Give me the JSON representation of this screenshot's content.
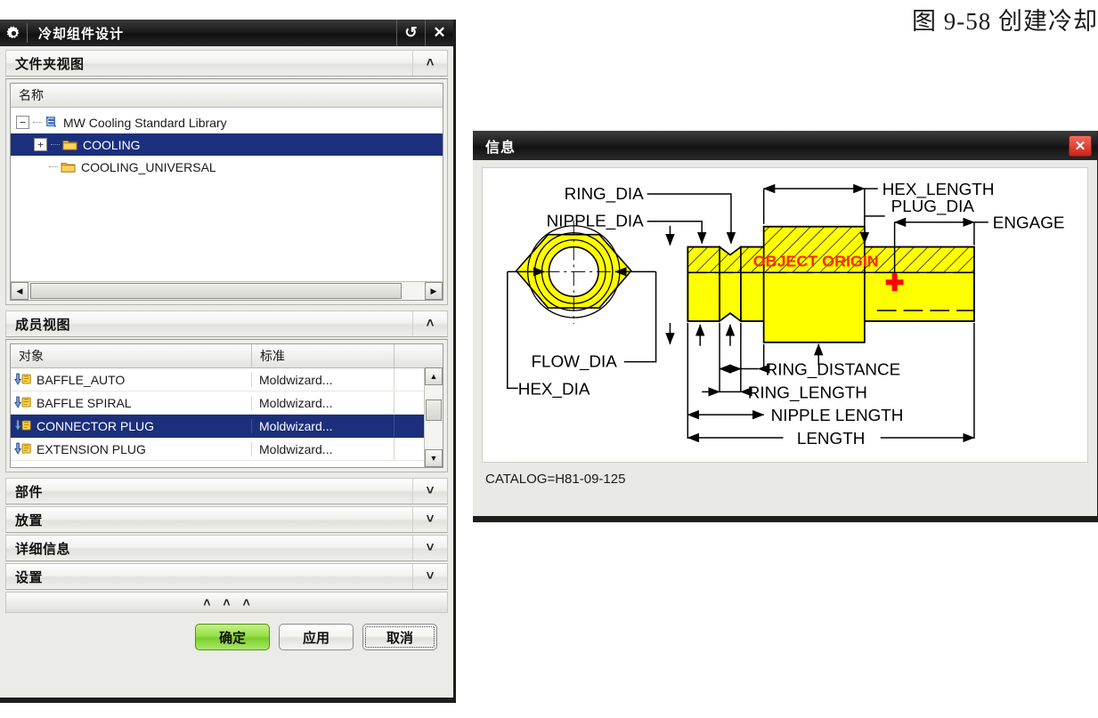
{
  "caption": "图 9-58  创建冷却",
  "dialog": {
    "title": "冷却组件设计",
    "icon": "gear-icon",
    "reset_label": "↺",
    "close_label": "✕",
    "sections": [
      {
        "label": "文件夹视图",
        "chevron": "˄",
        "expanded": true
      },
      {
        "label": "成员视图",
        "chevron": "˄",
        "expanded": true
      },
      {
        "label": "部件",
        "chevron": "˅",
        "expanded": false
      },
      {
        "label": "放置",
        "chevron": "˅",
        "expanded": false
      },
      {
        "label": "详细信息",
        "chevron": "˅",
        "expanded": false
      },
      {
        "label": "设置",
        "chevron": "˅",
        "expanded": false
      }
    ],
    "folder_view": {
      "column_header": "名称",
      "tree": [
        {
          "label": "MW Cooling Standard Library",
          "level": 0,
          "expander": "−",
          "icon": "library-icon",
          "selected": false
        },
        {
          "label": "COOLING",
          "level": 1,
          "expander": "+",
          "icon": "folder-icon",
          "selected": true
        },
        {
          "label": "COOLING_UNIVERSAL",
          "level": 1,
          "expander": "",
          "icon": "folder-icon",
          "selected": false
        }
      ],
      "hscroll": {
        "left_arrow": "◀",
        "right_arrow": "▶"
      }
    },
    "member_view": {
      "columns": [
        "对象",
        "标准",
        ""
      ],
      "rows": [
        {
          "object": "BAFFLE_AUTO",
          "standard": "Moldwizard...",
          "selected": false
        },
        {
          "object": "BAFFLE SPIRAL",
          "standard": "Moldwizard...",
          "selected": false
        },
        {
          "object": "CONNECTOR PLUG",
          "standard": "Moldwizard...",
          "selected": true
        },
        {
          "object": "EXTENSION PLUG",
          "standard": "Moldwizard...",
          "selected": false
        }
      ],
      "vscroll": {
        "up_arrow": "▲",
        "down_arrow": "▼"
      }
    },
    "collapse_all": {
      "marks": [
        "˄",
        "˄",
        "˄"
      ]
    },
    "buttons": {
      "ok": "确定",
      "apply": "应用",
      "cancel": "取消"
    }
  },
  "info_dialog": {
    "title": "信息",
    "close_label": "✕",
    "catalog": "CATALOG=H81-09-125",
    "drawing": {
      "origin_label": "OBJECT ORIGIN",
      "origin_color": "#ff0000",
      "part_color": "#ffff00",
      "labels": {
        "ring_dia": "RING_DIA",
        "nipple_dia": "NIPPLE_DIA",
        "hex_length": "HEX_LENGTH",
        "plug_dia": "PLUG_DIA",
        "engage": "ENGAGE",
        "flow_dia": "FLOW_DIA",
        "hex_dia": "HEX_DIA",
        "ring_distance": "RING_DISTANCE",
        "ring_length": "RING_LENGTH",
        "nipple_length": "NIPPLE  LENGTH",
        "length": "LENGTH"
      }
    }
  }
}
